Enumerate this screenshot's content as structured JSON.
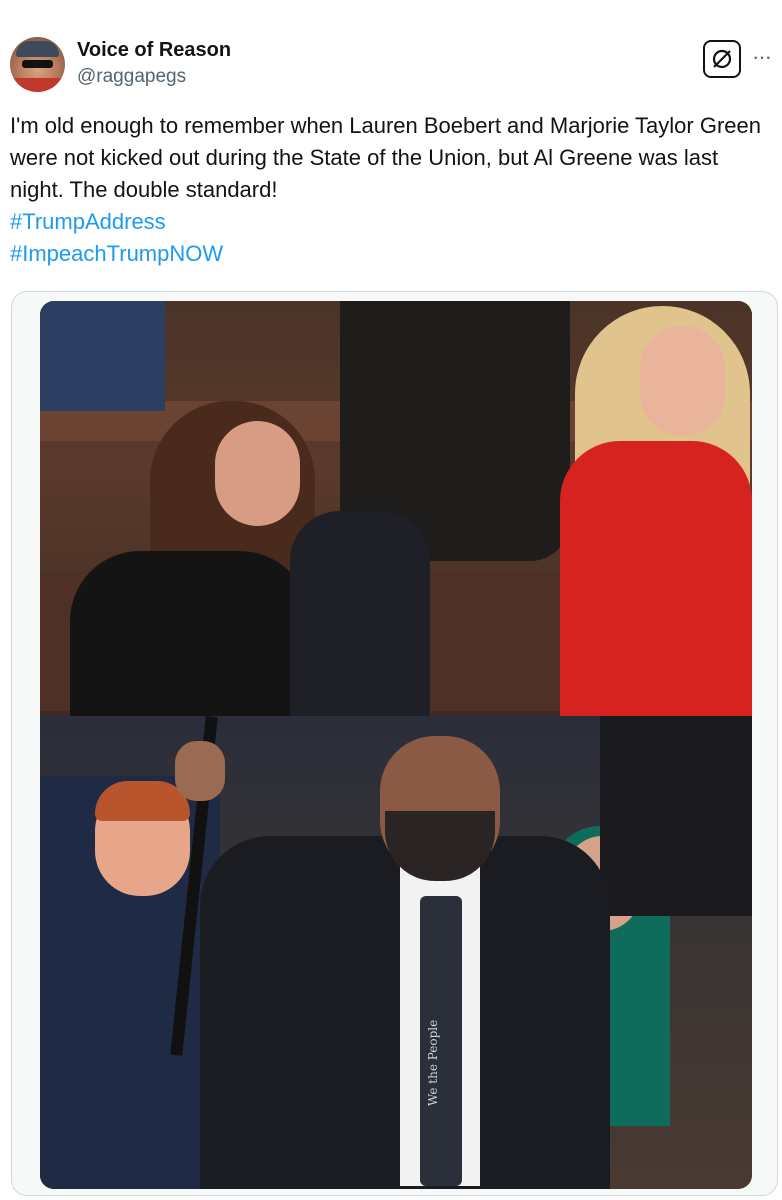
{
  "author": {
    "display_name": "Voice of Reason",
    "handle": "@raggapegs",
    "avatar_icon": "profile-photo"
  },
  "header_actions": {
    "grok_icon": "grok-icon",
    "more_label": "···"
  },
  "tweet": {
    "text": "I'm old enough to remember when Lauren Boebert and Marjorie Taylor Green were not kicked out during the State of the Union, but Al Greene was last night. The double standard!",
    "hashtags": [
      "#TrumpAddress",
      "#ImpeachTrumpNOW"
    ]
  },
  "media": {
    "tie_text": "We the People"
  },
  "colors": {
    "text": "#0f1419",
    "secondary": "#536471",
    "link": "#1d9bf0",
    "border": "#cfd9de"
  }
}
